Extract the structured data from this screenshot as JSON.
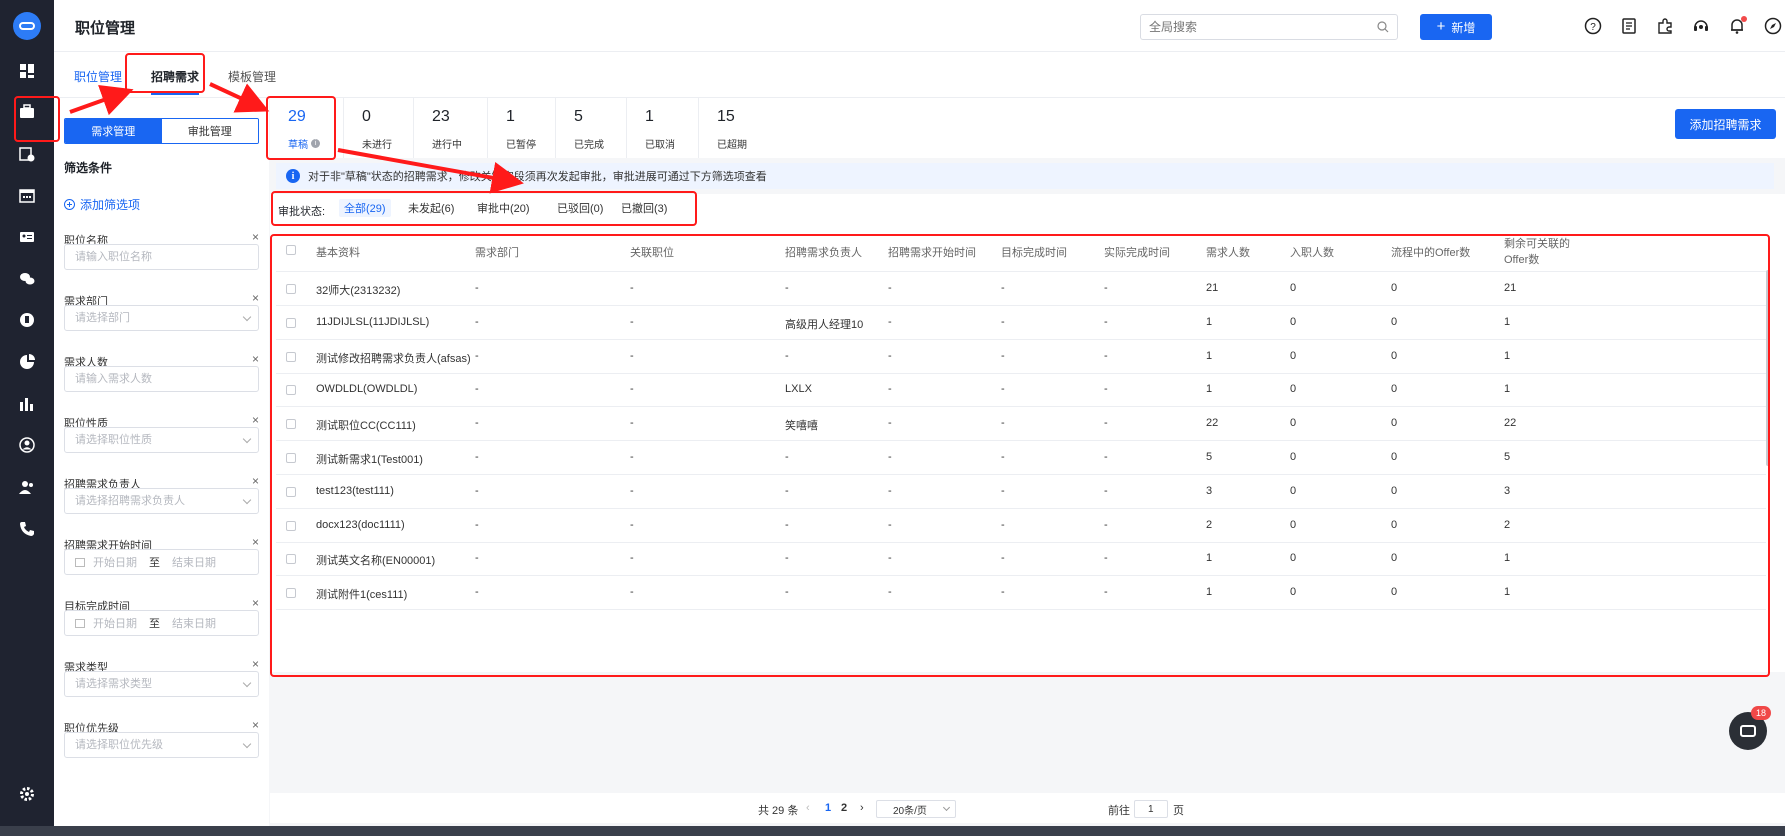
{
  "header": {
    "title": "职位管理",
    "search_placeholder": "全局搜索",
    "new_button": "新增"
  },
  "tabs": [
    "职位管理",
    "招聘需求",
    "模板管理"
  ],
  "segment": [
    "需求管理",
    "审批管理"
  ],
  "filter": {
    "title": "筛选条件",
    "add_filter": "添加筛选项",
    "fields": [
      {
        "label": "职位名称",
        "placeholder": "请输入职位名称",
        "type": "input"
      },
      {
        "label": "需求部门",
        "placeholder": "请选择部门",
        "type": "select"
      },
      {
        "label": "需求人数",
        "placeholder": "请输入需求人数",
        "type": "input"
      },
      {
        "label": "职位性质",
        "placeholder": "请选择职位性质",
        "type": "select"
      },
      {
        "label": "招聘需求负责人",
        "placeholder": "请选择招聘需求负责人",
        "type": "select"
      },
      {
        "label": "招聘需求开始时间",
        "start": "开始日期",
        "sep": "至",
        "end": "结束日期",
        "type": "range"
      },
      {
        "label": "目标完成时间",
        "start": "开始日期",
        "sep": "至",
        "end": "结束日期",
        "type": "range"
      },
      {
        "label": "需求类型",
        "placeholder": "请选择需求类型",
        "type": "select"
      },
      {
        "label": "职位优先级",
        "placeholder": "请选择职位优先级",
        "type": "select"
      }
    ]
  },
  "stats": [
    {
      "num": "29",
      "label": "草稿"
    },
    {
      "num": "0",
      "label": "未进行"
    },
    {
      "num": "23",
      "label": "进行中"
    },
    {
      "num": "1",
      "label": "已暂停"
    },
    {
      "num": "5",
      "label": "已完成"
    },
    {
      "num": "1",
      "label": "已取消"
    },
    {
      "num": "15",
      "label": "已超期"
    }
  ],
  "add_button": "添加招聘需求",
  "notice": "对于非\"草稿\"状态的招聘需求，修改关键字段须再次发起审批，审批进展可通过下方筛选项查看",
  "approval": {
    "label": "审批状态:",
    "chips": [
      "全部(29)",
      "未发起(6)",
      "审批中(20)",
      "已驳回(0)",
      "已撤回(3)"
    ]
  },
  "table": {
    "columns": [
      "基本资料",
      "需求部门",
      "关联职位",
      "招聘需求负责人",
      "招聘需求开始时间",
      "目标完成时间",
      "实际完成时间",
      "需求人数",
      "入职人数",
      "流程中的Offer数",
      "剩余可关联的Offer数"
    ],
    "rows": [
      [
        "32师大(2313232)",
        "-",
        "-",
        "-",
        "-",
        "-",
        "-",
        "21",
        "0",
        "0",
        "21"
      ],
      [
        "11JDIJLSL(11JDIJLSL)",
        "-",
        "-",
        "高级用人经理10",
        "-",
        "-",
        "-",
        "1",
        "0",
        "0",
        "1"
      ],
      [
        "测试修改招聘需求负责人(afsas)",
        "-",
        "-",
        "-",
        "-",
        "-",
        "-",
        "1",
        "0",
        "0",
        "1"
      ],
      [
        "OWDLDL(OWDLDL)",
        "-",
        "-",
        "LXLX",
        "-",
        "-",
        "-",
        "1",
        "0",
        "0",
        "1"
      ],
      [
        "测试职位CC(CC111)",
        "-",
        "-",
        "笑嘻嘻",
        "-",
        "-",
        "-",
        "22",
        "0",
        "0",
        "22"
      ],
      [
        "测试新需求1(Test001)",
        "-",
        "-",
        "-",
        "-",
        "-",
        "-",
        "5",
        "0",
        "0",
        "5"
      ],
      [
        "test123(test111)",
        "-",
        "-",
        "-",
        "-",
        "-",
        "-",
        "3",
        "0",
        "0",
        "3"
      ],
      [
        "docx123(doc1111)",
        "-",
        "-",
        "-",
        "-",
        "-",
        "-",
        "2",
        "0",
        "0",
        "2"
      ],
      [
        "测试英文名称(EN00001)",
        "-",
        "-",
        "-",
        "-",
        "-",
        "-",
        "1",
        "0",
        "0",
        "1"
      ],
      [
        "测试附件1(ces111)",
        "-",
        "-",
        "-",
        "-",
        "-",
        "-",
        "1",
        "0",
        "0",
        "1"
      ]
    ]
  },
  "pager": {
    "total": "共 29 条",
    "pages": [
      "1",
      "2"
    ],
    "page_size": "20条/页",
    "goto_label": "前往",
    "goto_value": "1",
    "goto_unit": "页"
  },
  "chat_badge": "18",
  "colors": {
    "primary": "#1966f2",
    "annotation": "#ff1a1a",
    "rail": "#1f2330"
  }
}
